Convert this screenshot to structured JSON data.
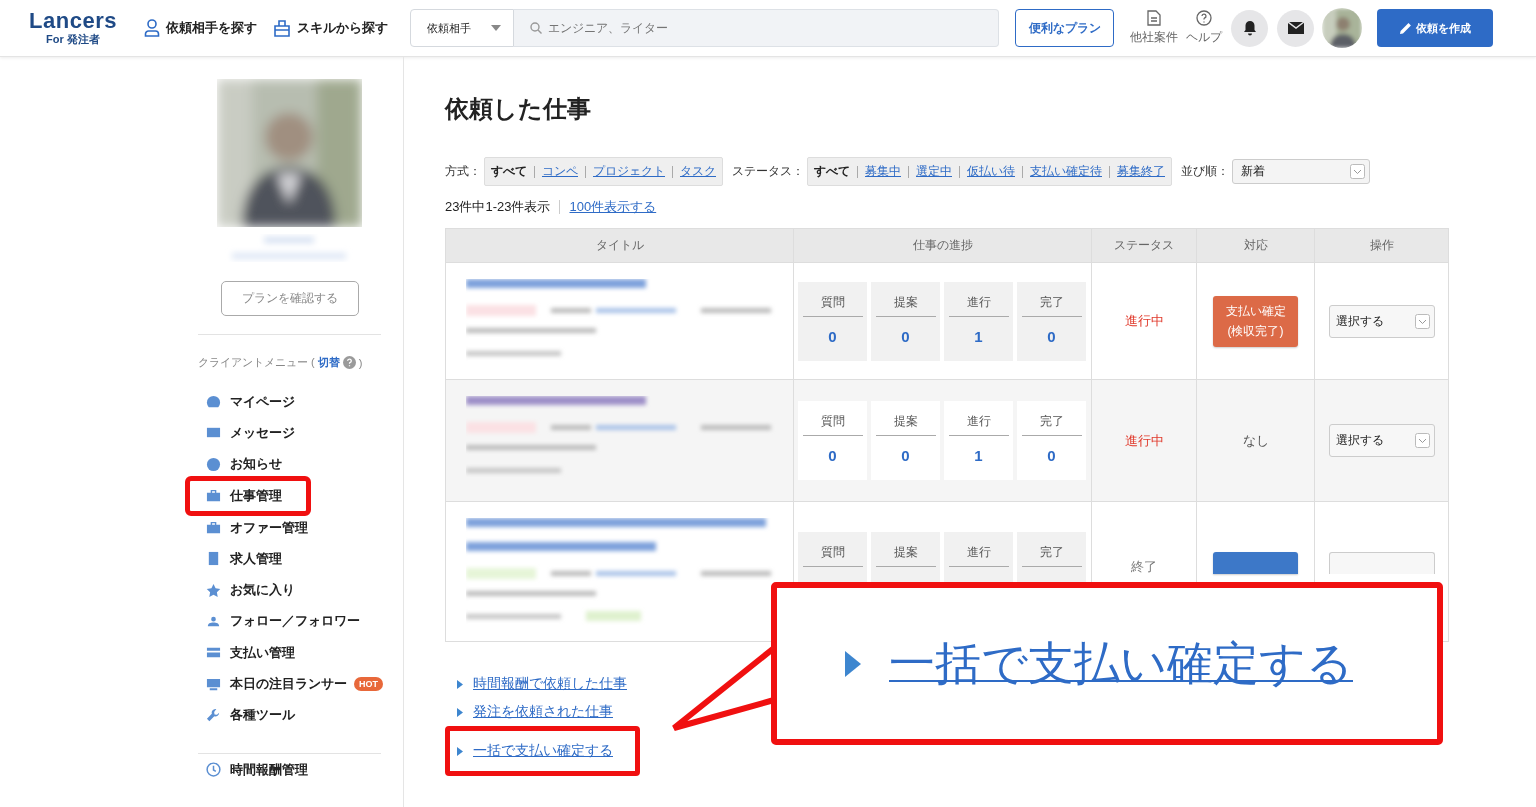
{
  "header": {
    "logo": "Lancers",
    "logo_sub": "For 発注者",
    "nav": [
      {
        "label": "依頼相手を探す"
      },
      {
        "label": "スキルから探す"
      }
    ],
    "search": {
      "scope": "依頼相手",
      "placeholder": "エンジニア、ライター"
    },
    "plan_button": "便利なプラン",
    "utilities": [
      {
        "label": "他社案件"
      },
      {
        "label": "ヘルプ"
      }
    ],
    "create_button": "依頼を作成"
  },
  "sidebar": {
    "plan_button": "プランを確認する",
    "menu_heading": "クライアントメニュー (",
    "switch_link": "切替",
    "heading_close": ")",
    "items": [
      {
        "label": "マイページ",
        "highlighted": false
      },
      {
        "label": "メッセージ",
        "highlighted": false
      },
      {
        "label": "お知らせ",
        "highlighted": false
      },
      {
        "label": "仕事管理",
        "highlighted": true
      },
      {
        "label": "オファー管理",
        "highlighted": false
      },
      {
        "label": "求人管理",
        "highlighted": false
      },
      {
        "label": "お気に入り",
        "highlighted": false
      },
      {
        "label": "フォロー／フォロワー",
        "highlighted": false
      },
      {
        "label": "支払い管理",
        "highlighted": false
      },
      {
        "label": "本日の注目ランサー",
        "highlighted": false,
        "badge": "HOT"
      },
      {
        "label": "各種ツール",
        "highlighted": false
      }
    ],
    "bottom_items": [
      {
        "label": "時間報酬管理"
      }
    ]
  },
  "main": {
    "title": "依頼した仕事",
    "filters": [
      {
        "label": "方式：",
        "options": [
          {
            "label": "すべて",
            "selected": true
          },
          {
            "label": "コンペ",
            "selected": false
          },
          {
            "label": "プロジェクト",
            "selected": false
          },
          {
            "label": "タスク",
            "selected": false
          }
        ]
      },
      {
        "label": "ステータス：",
        "options": [
          {
            "label": "すべて",
            "selected": true
          },
          {
            "label": "募集中",
            "selected": false
          },
          {
            "label": "選定中",
            "selected": false
          },
          {
            "label": "仮払い待",
            "selected": false
          },
          {
            "label": "支払い確定待",
            "selected": false
          },
          {
            "label": "募集終了",
            "selected": false
          }
        ]
      }
    ],
    "sort": {
      "label": "並び順：",
      "value": "新着"
    },
    "count": "23件中1-23件表示",
    "show_more": "100件表示する",
    "table": {
      "columns": [
        "タイトル",
        "仕事の進捗",
        "ステータス",
        "対応",
        "操作"
      ],
      "rows": [
        {
          "progress": [
            {
              "label": "質問",
              "value": "0"
            },
            {
              "label": "提案",
              "value": "0"
            },
            {
              "label": "進行",
              "value": "1"
            },
            {
              "label": "完了",
              "value": "0"
            }
          ],
          "status": "進行中",
          "color": "#e0392b",
          "action": {
            "kind": "button",
            "lines": [
              "支払い確定",
              "(検収完了)"
            ],
            "color": "#dc6a47"
          },
          "operation": "選択する"
        },
        {
          "progress": [
            {
              "label": "質問",
              "value": "0"
            },
            {
              "label": "提案",
              "value": "0"
            },
            {
              "label": "進行",
              "value": "1"
            },
            {
              "label": "完了",
              "value": "0"
            }
          ],
          "status": "進行中",
          "color": "#e0392b",
          "action": {
            "kind": "text",
            "lines": [
              "なし"
            ]
          },
          "operation": "選択する"
        },
        {
          "progress": [
            {
              "label": "質問"
            },
            {
              "label": "提案"
            },
            {
              "label": "進行"
            },
            {
              "label": "完了"
            }
          ],
          "status": "終了",
          "color": "#777777",
          "action": {
            "kind": "button",
            "color": "#3d78c8"
          }
        }
      ]
    },
    "links": [
      {
        "label": "時間報酬で依頼した仕事",
        "highlighted": false
      },
      {
        "label": "発注を依頼された仕事",
        "highlighted": false
      },
      {
        "label": "一括で支払い確定する",
        "highlighted": true
      }
    ]
  },
  "callout": {
    "text": "一括で支払い確定する"
  }
}
